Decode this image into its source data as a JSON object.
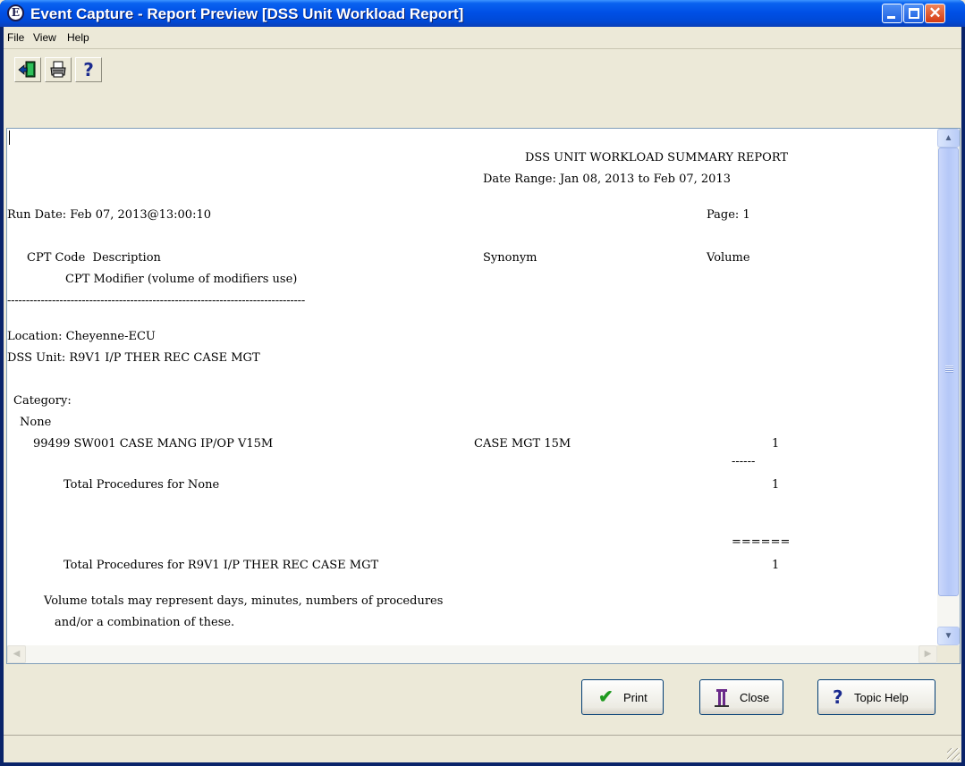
{
  "window": {
    "title": "Event Capture - Report Preview [DSS Unit Workload Report]",
    "app_icon_letter": "E"
  },
  "menu": {
    "file": "File",
    "view": "View",
    "help": "Help"
  },
  "toolbar": {
    "exit_icon": "exit-door-icon",
    "print_icon": "printer-icon",
    "help_icon": "question-mark-icon",
    "help_glyph": "?"
  },
  "report": {
    "title": "DSS UNIT WORKLOAD SUMMARY REPORT",
    "date_range": "Date Range: Jan 08, 2013 to Feb 07, 2013",
    "run_date": "Run Date: Feb 07, 2013@13:00:10",
    "page": "Page: 1",
    "col_cpt": "CPT Code  Description",
    "col_synonym": "Synonym",
    "col_volume": "Volume",
    "col_modifier": "CPT Modifier (volume of modifiers use)",
    "separator": "--------------------------------------------------------------------------------",
    "location": "Location: Cheyenne-ECU",
    "dss_unit": "DSS Unit: R9V1 I/P THER REC CASE MGT",
    "category_label": "Category:",
    "category_name": "None",
    "procedure": "99499 SW001 CASE MANG IP/OP V15M",
    "procedure_synonym": "CASE MGT 15M",
    "procedure_volume": "1",
    "subtotal_dashes": "------",
    "total_none_label": "Total Procedures for None",
    "total_none_volume": "1",
    "grand_total_line": "======",
    "total_unit_label": "Total Procedures for R9V1 I/P THER REC CASE MGT",
    "total_unit_volume": "1",
    "note_line1": "Volume totals may represent days, minutes, numbers of procedures",
    "note_line2": "and/or a combination of these."
  },
  "buttons": {
    "print": "Print",
    "close": "Close",
    "topic_help": "Topic Help"
  },
  "colors": {
    "title_bar": "#0050e6",
    "window_face": "#ece9d8",
    "print_check": "#1f9a1f",
    "close_icon": "#6a2a8a",
    "help_icon": "#1b2b8f"
  }
}
